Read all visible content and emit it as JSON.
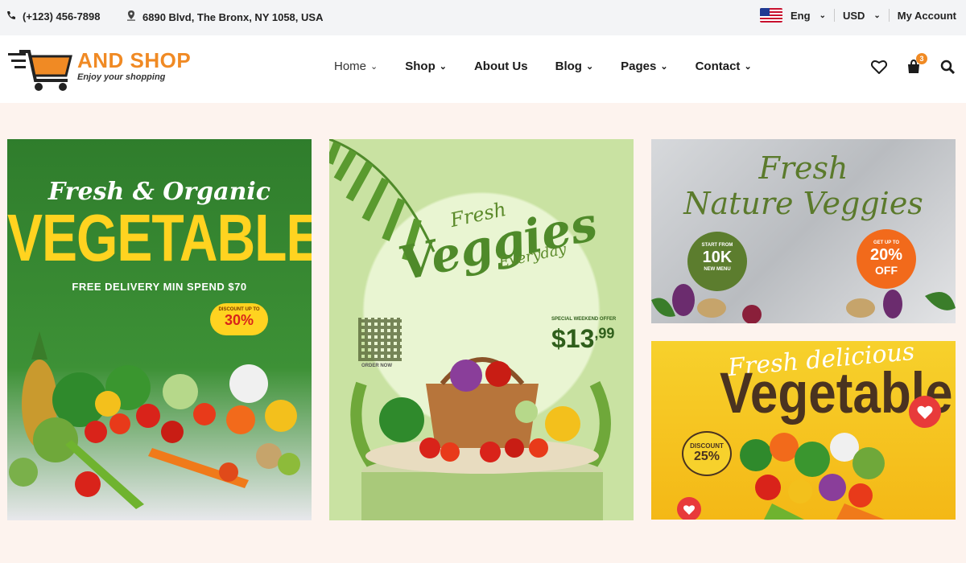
{
  "topbar": {
    "phone": "(+123) 456-7898",
    "address": "6890 Blvd, The Bronx, NY 1058, USA",
    "language": "Eng",
    "currency": "USD",
    "account": "My Account"
  },
  "brand": {
    "name": "AND SHOP",
    "tagline": "Enjoy your shopping",
    "accent": "#f08a24"
  },
  "nav": {
    "items": [
      {
        "label": "Home"
      },
      {
        "label": "Shop"
      },
      {
        "label": "About Us"
      },
      {
        "label": "Blog"
      },
      {
        "label": "Pages"
      },
      {
        "label": "Contact"
      }
    ]
  },
  "header_icons": {
    "wishlist": "heart-icon",
    "cart": "shopping-bag-icon",
    "cart_count": "3",
    "search": "search-icon"
  },
  "banners": {
    "organic": {
      "subtitle": "Fresh & Organic",
      "title": "VEGETABLES",
      "delivery": "FREE DELIVERY MIN SPEND $70",
      "discount_small": "DISCOUNT UP TO",
      "discount": "30%"
    },
    "veggies": {
      "fresh": "Fresh",
      "title": "Veggies",
      "everyday": "Everyday",
      "order_now": "ORDER NOW",
      "offer": "SPECIAL WEEKEND OFFER",
      "price": "$13",
      "price_cents": ",99"
    },
    "nature": {
      "line1": "Fresh",
      "line2": "Nature Veggies",
      "start_from": "START FROM",
      "start_value": "10K",
      "start_foot": "NEW MENU",
      "get_up_to": "GET UP TO",
      "off_value": "20%",
      "off_label": "OFF"
    },
    "delicious": {
      "script": "Fresh delicious",
      "title": "Vegetable",
      "discount_label": "DISCOUNT",
      "discount_value": "25%"
    }
  }
}
